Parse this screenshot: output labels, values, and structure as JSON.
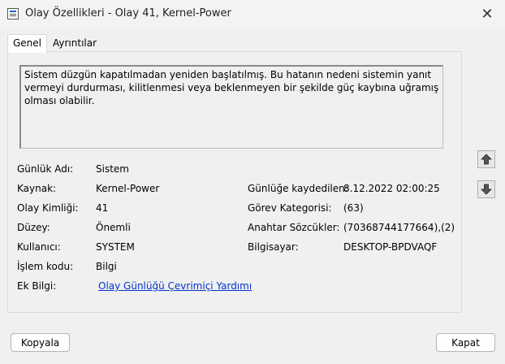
{
  "window": {
    "title": "Olay Özellikleri - Olay 41, Kernel-Power",
    "close_glyph": "✕"
  },
  "tabs": [
    {
      "label": "Genel"
    },
    {
      "label": "Ayrıntılar"
    }
  ],
  "description": "Sistem düzgün kapatılmadan yeniden başlatılmış. Bu hatanın nedeni sistemin yanıt vermeyi durdurması, kilitlenmesi veya beklenmeyen bir şekilde güç kaybına uğramış olması olabilir.",
  "fields": {
    "log_name": {
      "label": "Günlük Adı:",
      "value": "Sistem"
    },
    "source": {
      "label": "Kaynak:",
      "value": "Kernel-Power"
    },
    "event_id": {
      "label": "Olay Kimliği:",
      "value": "41"
    },
    "level": {
      "label": "Düzey:",
      "value": "Önemli"
    },
    "user": {
      "label": "Kullanıcı:",
      "value": "SYSTEM"
    },
    "opcode": {
      "label": "İşlem kodu:",
      "value": "Bilgi"
    },
    "more_info": {
      "label": "Ek Bilgi:",
      "value": "Olay Günlüğü Çevrimiçi Yardımı"
    },
    "logged": {
      "label": "Günlüğe kaydedilen:",
      "value": "8.12.2022 02:00:25"
    },
    "task_category": {
      "label": "Görev Kategorisi:",
      "value": "(63)"
    },
    "keywords": {
      "label": "Anahtar Sözcükler:",
      "value": "(70368744177664),(2)"
    },
    "computer": {
      "label": "Bilgisayar:",
      "value": "DESKTOP-BPDVAQF"
    }
  },
  "buttons": {
    "copy": "Kopyala",
    "close": "Kapat"
  },
  "icons": {
    "up": "arrow-up-icon",
    "down": "arrow-down-icon"
  }
}
